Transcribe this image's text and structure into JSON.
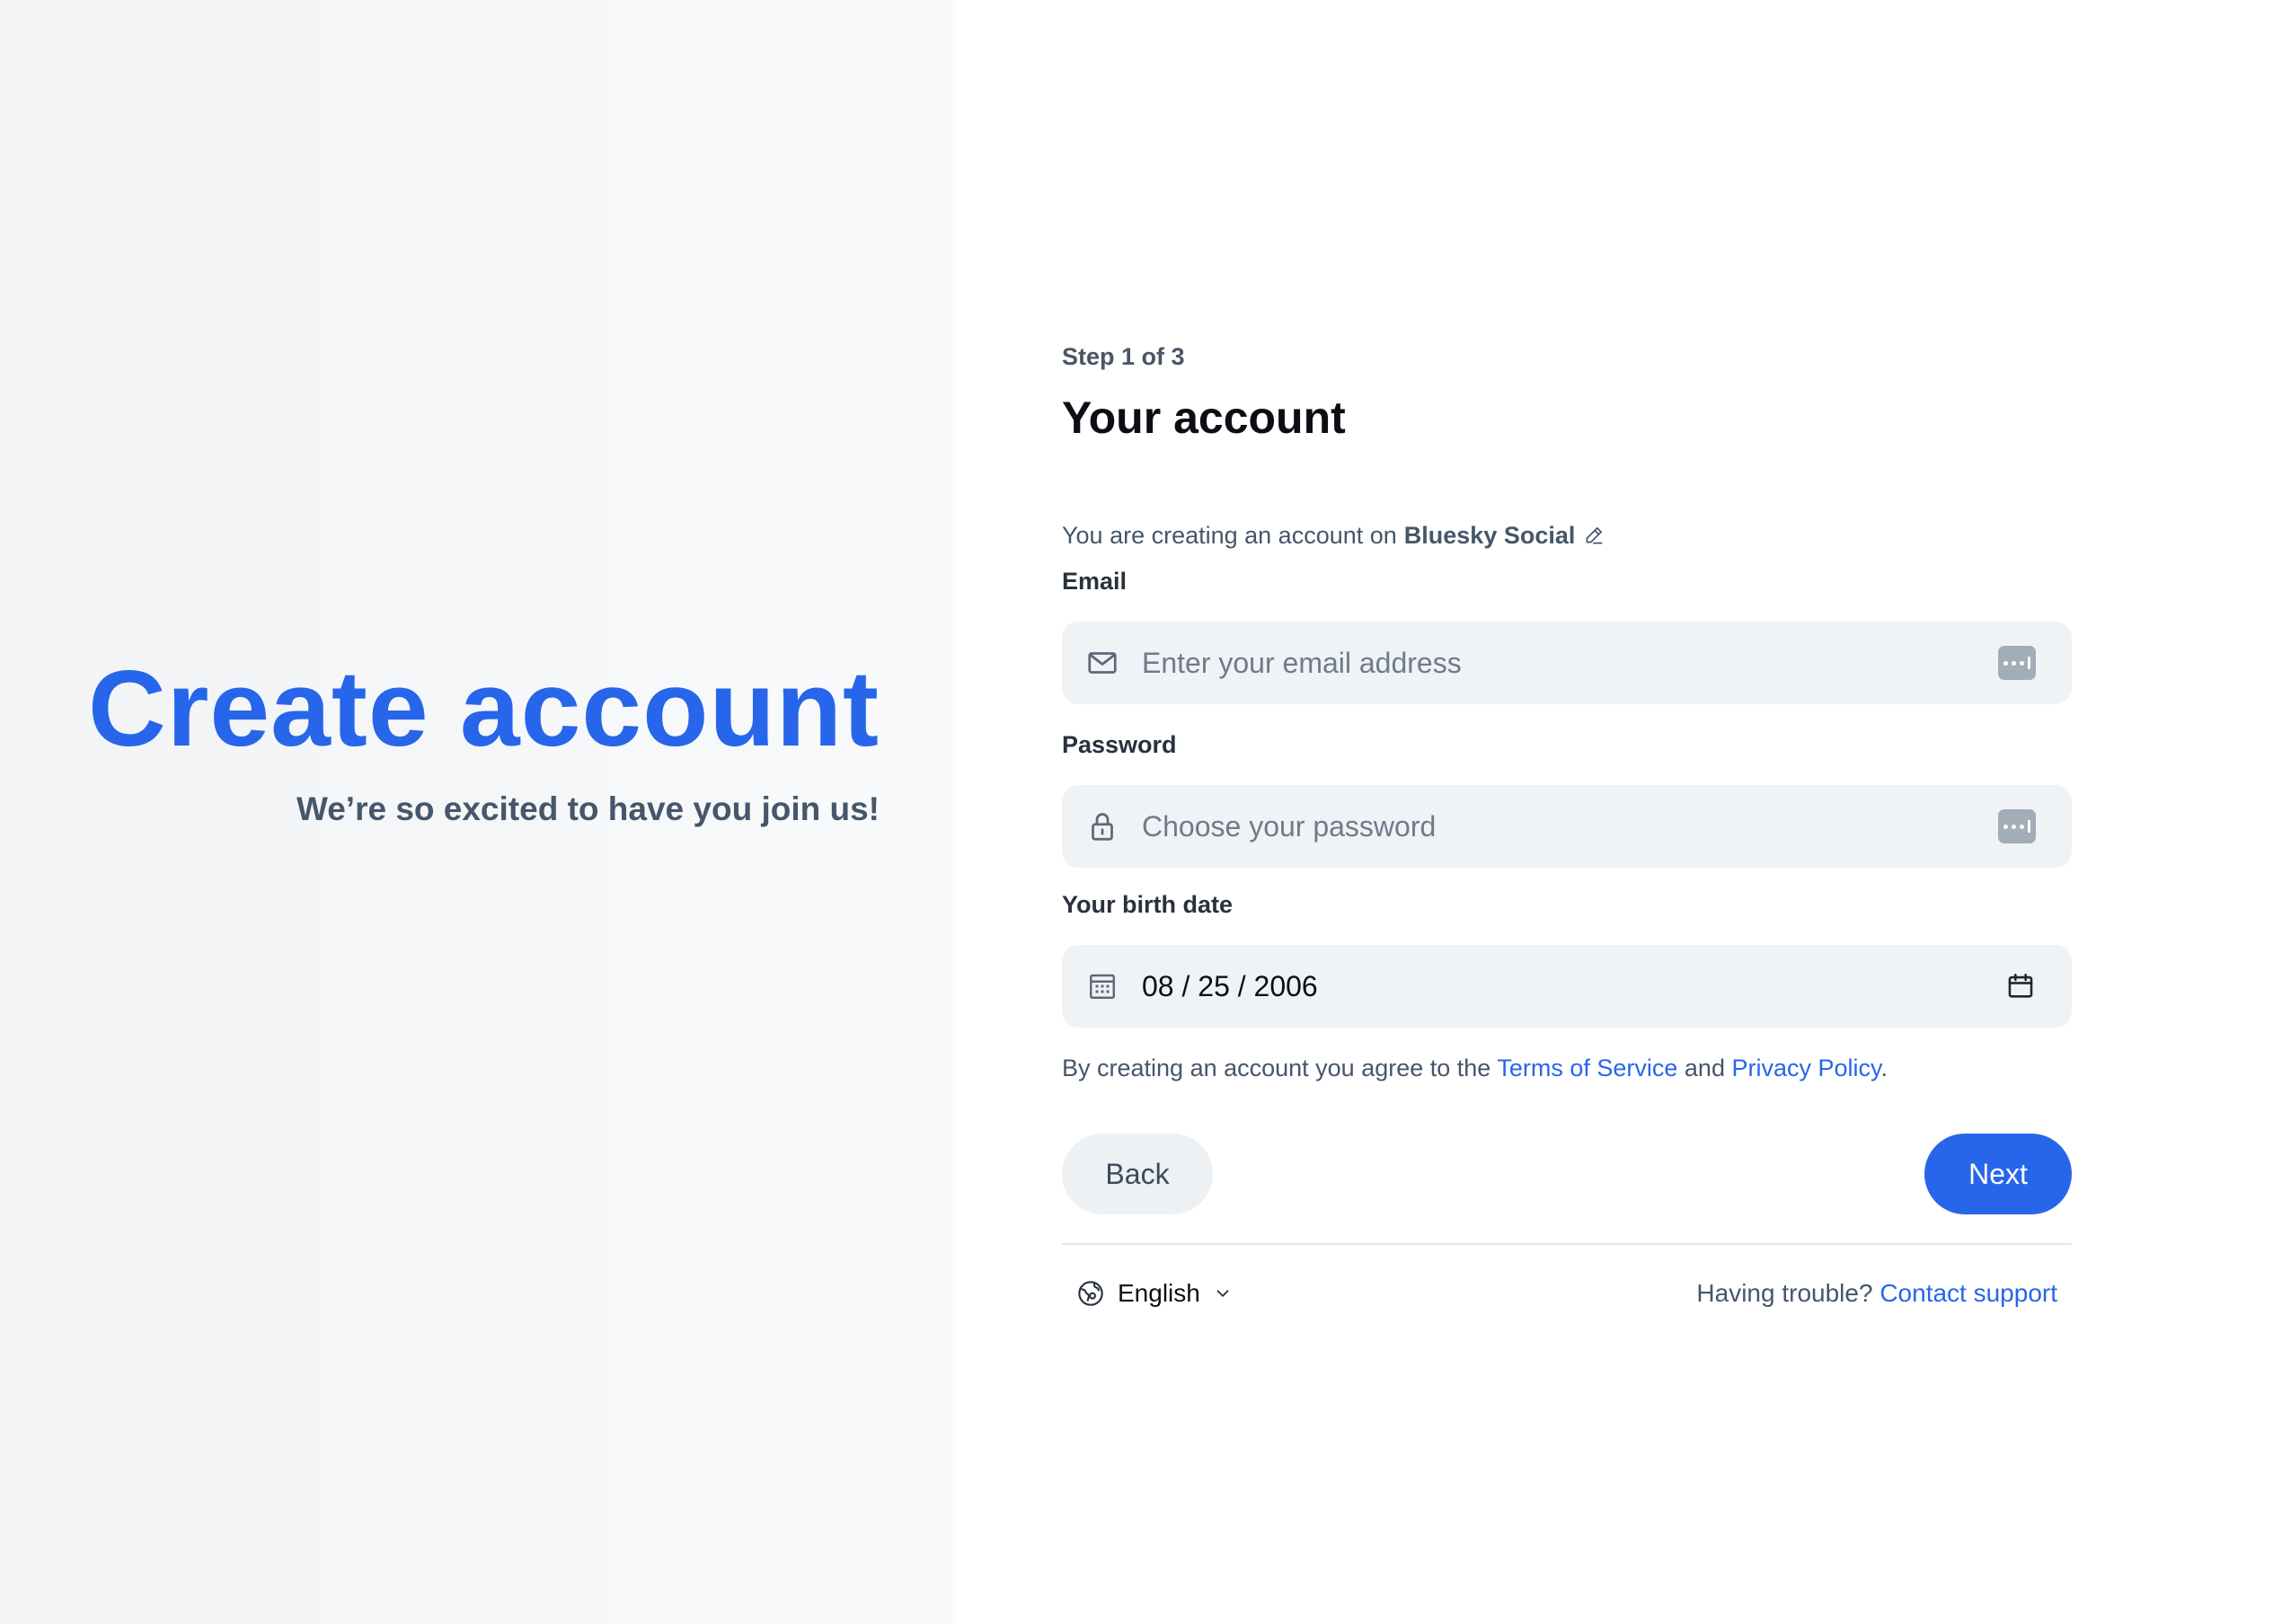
{
  "hero": {
    "title": "Create account",
    "subtitle": "We’re so excited to have you join us!"
  },
  "form": {
    "step_label": "Step 1 of 3",
    "title": "Your account",
    "service_prefix": "You are creating an account on",
    "service_name": "Bluesky Social",
    "email": {
      "label": "Email",
      "placeholder": "Enter your email address",
      "value": ""
    },
    "password": {
      "label": "Password",
      "placeholder": "Choose your password",
      "value": ""
    },
    "birthdate": {
      "label": "Your birth date",
      "value": "08 / 25 / 2006"
    },
    "terms": {
      "prefix": "By creating an account you agree to the",
      "tos_link": "Terms of Service",
      "and": "and",
      "privacy_link": "Privacy Policy",
      "suffix": "."
    },
    "back_label": "Back",
    "next_label": "Next"
  },
  "footer": {
    "language": "English",
    "support_prefix": "Having trouble?",
    "support_link": "Contact support"
  },
  "colors": {
    "accent": "#2766ea",
    "left_bg": "#f1f3f5",
    "input_bg": "#f0f3f6"
  },
  "icons": {
    "edit": "pencil-icon",
    "email": "envelope-icon",
    "password": "lock-icon",
    "birthdate": "calendar-grid-icon",
    "date_picker": "calendar-icon",
    "password_manager": "password-key-icon",
    "language": "globe-icon",
    "dropdown": "chevron-down-icon"
  }
}
